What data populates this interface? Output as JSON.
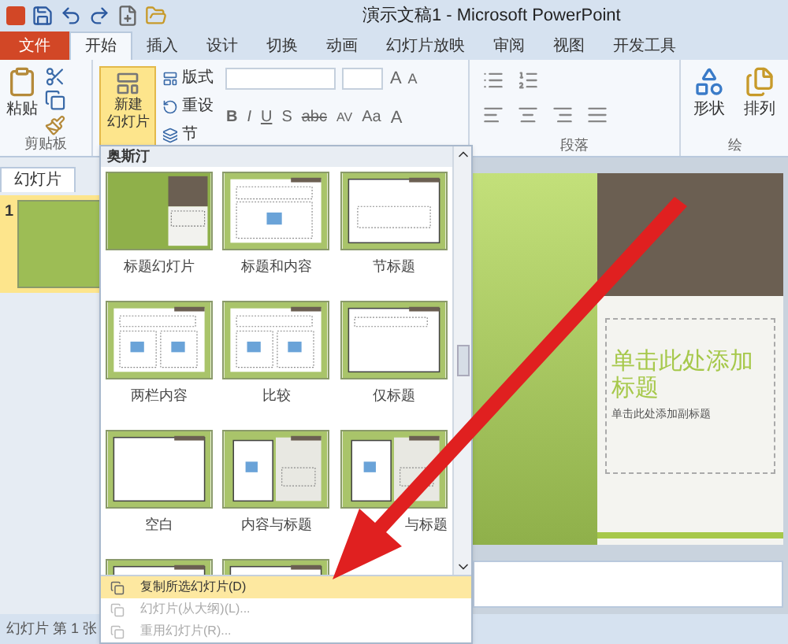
{
  "title_bar": {
    "title": "演示文稿1 - Microsoft PowerPoint"
  },
  "tabs": [
    {
      "label": "文件",
      "kind": "file",
      "selected": false
    },
    {
      "label": "开始",
      "kind": "tab",
      "selected": true
    },
    {
      "label": "插入",
      "kind": "tab",
      "selected": false
    },
    {
      "label": "设计",
      "kind": "tab",
      "selected": false
    },
    {
      "label": "切换",
      "kind": "tab",
      "selected": false
    },
    {
      "label": "动画",
      "kind": "tab",
      "selected": false
    },
    {
      "label": "幻灯片放映",
      "kind": "tab",
      "selected": false
    },
    {
      "label": "审阅",
      "kind": "tab",
      "selected": false
    },
    {
      "label": "视图",
      "kind": "tab",
      "selected": false
    },
    {
      "label": "开发工具",
      "kind": "tab",
      "selected": false
    }
  ],
  "ribbon": {
    "clipboard": {
      "paste": "粘贴",
      "label": "剪贴板"
    },
    "slides": {
      "new_slide": [
        "新建",
        "幻灯片"
      ],
      "layout": "版式",
      "reset": "重设",
      "section": "节"
    },
    "font": {
      "grow": "A",
      "shrink": "A",
      "bold": "B",
      "italic": "I",
      "underline": "U",
      "strike": "S",
      "abc": "abc",
      "spacing": "AV",
      "case": "Aa",
      "text_color": "A"
    },
    "paragraph": {
      "label": "段落"
    },
    "drawing": {
      "shape": "形状",
      "arrange": "排列",
      "label": "绘"
    }
  },
  "left_pane": {
    "tabs": [
      {
        "label": "幻灯片",
        "selected": true
      }
    ],
    "slide_number": "1"
  },
  "gallery": {
    "header": "奥斯汀",
    "layouts": [
      {
        "label": "标题幻灯片",
        "kind": "title"
      },
      {
        "label": "标题和内容",
        "kind": "content"
      },
      {
        "label": "节标题",
        "kind": "section"
      },
      {
        "label": "两栏内容",
        "kind": "two"
      },
      {
        "label": "比较",
        "kind": "compare"
      },
      {
        "label": "仅标题",
        "kind": "titleonly"
      },
      {
        "label": "空白",
        "kind": "blank"
      },
      {
        "label": "内容与标题",
        "kind": "side"
      },
      {
        "label": "与标题",
        "kind": "picture"
      },
      {
        "kind": "blank"
      },
      {
        "kind": "blank"
      }
    ],
    "menu": [
      {
        "label": "复制所选幻灯片(D)",
        "selected": true,
        "disabled": false
      },
      {
        "label": "幻灯片(从大纲)(L)...",
        "selected": false,
        "disabled": true
      },
      {
        "label": "重用幻灯片(R)...",
        "selected": false,
        "disabled": true
      }
    ]
  },
  "slide": {
    "title": "单击此处添加标题",
    "subtitle": "单击此处添加副标题"
  },
  "status_bar": {
    "text": "幻灯片 第 1 张"
  }
}
